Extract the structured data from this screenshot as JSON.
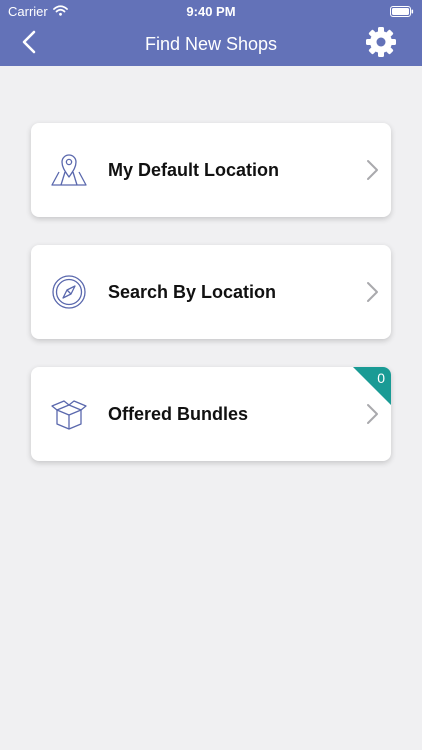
{
  "status_bar": {
    "carrier": "Carrier",
    "time": "9:40 PM",
    "wifi_icon": "wifi-icon",
    "battery_icon": "battery-icon"
  },
  "nav": {
    "title": "Find New Shops",
    "back_icon": "chevron-left-icon",
    "settings_icon": "gear-icon"
  },
  "menu": {
    "items": [
      {
        "label": "My Default Location",
        "icon": "map-pin-icon"
      },
      {
        "label": "Search By Location",
        "icon": "compass-icon"
      },
      {
        "label": "Offered Bundles",
        "icon": "box-icon",
        "badge": "0"
      }
    ]
  },
  "colors": {
    "header": "#6372b8",
    "background": "#f0f0f2",
    "icon": "#5a68ad",
    "badge": "#1a9b95"
  }
}
